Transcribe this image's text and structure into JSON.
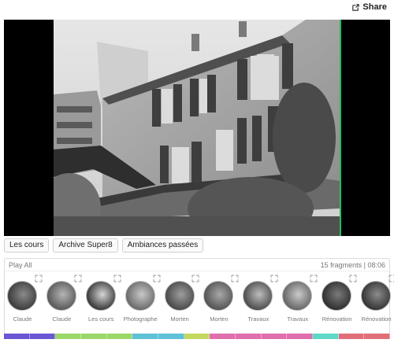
{
  "header": {
    "share_label": "Share",
    "share_icon": "external-share-icon"
  },
  "player": {
    "frame_edge_color": "#1fbf60",
    "overlay_color": "#000000"
  },
  "collections": [
    "Les cours",
    "Archive Super8",
    "Ambiances passées"
  ],
  "playlist": {
    "play_all_label": "Play All",
    "summary": "15 fragments | 08:06",
    "expand_icon": "expand-arrows-icon",
    "fragments": [
      {
        "label": "Claude"
      },
      {
        "label": "Claude"
      },
      {
        "label": "Les cours"
      },
      {
        "label": "Photographe"
      },
      {
        "label": "Morten"
      },
      {
        "label": "Morten"
      },
      {
        "label": "Travaux"
      },
      {
        "label": "Travaux"
      },
      {
        "label": "Rénovation"
      },
      {
        "label": "Rénovation"
      }
    ]
  },
  "timeline": {
    "segments": [
      {
        "color": "#6a57d4"
      },
      {
        "color": "#6a57d4"
      },
      {
        "color": "#9bd86a"
      },
      {
        "color": "#9bd86a"
      },
      {
        "color": "#9bd86a"
      },
      {
        "color": "#5ec1d8"
      },
      {
        "color": "#5ec1d8"
      },
      {
        "color": "#c2d85e"
      },
      {
        "color": "#e06fae"
      },
      {
        "color": "#e06fae"
      },
      {
        "color": "#e06fae"
      },
      {
        "color": "#e06fae"
      },
      {
        "color": "#5ed8c7"
      },
      {
        "color": "#e06f7a"
      },
      {
        "color": "#e06f7a"
      }
    ]
  }
}
